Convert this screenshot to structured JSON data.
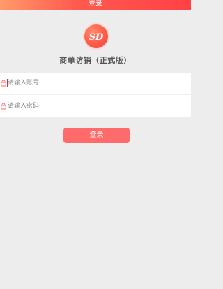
{
  "header": {
    "title": "登录"
  },
  "logo": {
    "text": "SD"
  },
  "app_title": "商单访销（正式版）",
  "form": {
    "account": {
      "placeholder": "请输入账号",
      "value": ""
    },
    "password": {
      "placeholder": "请输入密码",
      "value": ""
    }
  },
  "login_button": {
    "label": "登录"
  },
  "colors": {
    "accent": "#ff4146",
    "button": "#ff6a6a",
    "background": "#ededed"
  }
}
